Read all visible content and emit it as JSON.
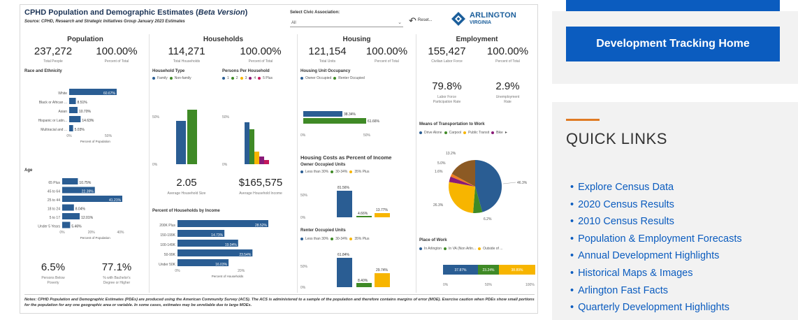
{
  "dashboard": {
    "title_main": "CPHD Population and Demographic Estimates (",
    "title_italic": "Beta Version",
    "title_end": ")",
    "source": "Source: CPHD, Research and Strategic Initiatives Group January 2023 Estimates",
    "civic_label": "Select Civic Association:",
    "civic_value": "All",
    "reset_label": "Reset...",
    "logo_line1": "ARLINGTON",
    "logo_line2": "VIRGINIA",
    "notes": "Notes: CPHD Population and Demographic Estimates (PDEs) are produced using the American Community Survey (ACS). The ACS is administered to a sample of the population and therefore contains margins of error (MOE). Exercise caution when PDEs show small portions for the population for any one geographic area or variable. In some cases, estimates may be unreliable due to large MOEs."
  },
  "population": {
    "title": "Population",
    "total": "237,272",
    "total_label": "Total People",
    "pct": "100.00%",
    "pct_label": "Percent of Total",
    "race_title": "Race and Ethnicity",
    "race": [
      {
        "label": "White",
        "value": 60.67,
        "text": "60.67%"
      },
      {
        "label": "Black or African ...",
        "value": 8.51,
        "text": "8.51%"
      },
      {
        "label": "Asian",
        "value": 10.7,
        "text": "10.70%"
      },
      {
        "label": "Hispanic or Latin...",
        "value": 14.63,
        "text": "14.63%"
      },
      {
        "label": "Multiracial and ...",
        "value": 5.03,
        "text": "5.03%"
      }
    ],
    "race_ticks": [
      "0%",
      "50%"
    ],
    "race_axis": "Percent of Population",
    "age_title": "Age",
    "age": [
      {
        "label": "65 Plus",
        "value": 10.75,
        "text": "10.75%"
      },
      {
        "label": "45 to 64",
        "value": 22.39,
        "text": "22.39%"
      },
      {
        "label": "25 to 44",
        "value": 41.21,
        "text": "41.21%"
      },
      {
        "label": "18 to 24",
        "value": 8.04,
        "text": "8.04%"
      },
      {
        "label": "5 to 17",
        "value": 12.01,
        "text": "12.01%"
      },
      {
        "label": "Under 5 Years",
        "value": 5.46,
        "text": "5.46%"
      }
    ],
    "age_ticks": [
      "0%",
      "20%",
      "40%"
    ],
    "age_axis": "Percent of Population",
    "poverty": "6.5%",
    "poverty_label1": "Persons Below",
    "poverty_label2": "Poverty",
    "bachelor": "77.1%",
    "bachelor_label1": "% with Bachelor's",
    "bachelor_label2": "Degree or Higher"
  },
  "households": {
    "title": "Households",
    "total": "114,271",
    "total_label": "Total Households",
    "pct": "100.00%",
    "pct_label": "Percent of Total",
    "type_title": "Household Type",
    "type_legend": [
      "Family",
      "Non-family"
    ],
    "pph_title": "Persons Per Household",
    "pph_legend": [
      "1",
      "2",
      "3",
      "4",
      "5 Plus"
    ],
    "tick_50": "50%",
    "tick_0": "0%",
    "avg_size": "2.05",
    "avg_size_label": "Average Household Size",
    "avg_income": "$165,575",
    "avg_income_label": "Average Household Income",
    "income_title": "Percent of Households by Income",
    "income": [
      {
        "label": "200K Plus",
        "value": 28.52,
        "text": "28.52%"
      },
      {
        "label": "150-199K",
        "value": 14.73,
        "text": "14.73%"
      },
      {
        "label": "100-149K",
        "value": 19.04,
        "text": "19.04%"
      },
      {
        "label": "50-99K",
        "value": 23.54,
        "text": "23.54%"
      },
      {
        "label": "Under 50K",
        "value": 16.03,
        "text": "16.03%"
      }
    ],
    "income_ticks": [
      "0%",
      "20%"
    ],
    "income_axis": "Percent of Households"
  },
  "housing": {
    "title": "Housing",
    "total": "121,154",
    "total_label": "Total Units",
    "pct": "100.00%",
    "pct_label": "Percent of Total",
    "occ_title": "Housing Unit Occupancy",
    "occ_legend": [
      "Owner Occupied",
      "Renter Occupied"
    ],
    "occ_owner": "38.34%",
    "occ_renter": "61.66%",
    "occ_ticks": [
      "0%",
      "50%"
    ],
    "costs_title": "Housing Costs as Percent of Income",
    "owner_title": "Owner Occupied Units",
    "costs_legend": [
      "Less than 30%",
      "30-34%",
      "35% Plus"
    ],
    "owner_vals": [
      "81.56%",
      "4.66%",
      "13.77%"
    ],
    "renter_title": "Renter Occupied Units",
    "renter_vals": [
      "61.84%",
      "8.40%",
      "29.74%"
    ],
    "tick_50": "50%",
    "tick_0": "0%"
  },
  "employment": {
    "title": "Employment",
    "total": "155,427",
    "total_label": "Civilian Labor Force",
    "pct": "100.00%",
    "pct_label": "Percent of Total",
    "lfpr": "79.8%",
    "lfpr_label1": "Labor Force",
    "lfpr_label2": "Participation Rate",
    "unemp": "2.9%",
    "unemp_label1": "Unemployment",
    "unemp_label2": "Rate",
    "transport_title": "Means of Transportation to Work",
    "transport_legend": [
      "Drive Alone",
      "Carpool",
      "Public Transit",
      "Bike"
    ],
    "pie_labels": [
      "46.3%",
      "26.3%",
      "6.2%",
      "13.2%",
      "5.0%",
      "1.6%"
    ],
    "place_title": "Place of Work",
    "place_legend": [
      "In Arlington",
      "In VA (Non Arlin...",
      "Outside of ..."
    ],
    "place_vals": [
      "37.87%",
      "23.24%",
      "38.89%"
    ],
    "place_ticks": [
      "0%",
      "50%",
      "100%"
    ]
  },
  "colors": {
    "blue": "#2a5d93",
    "green": "#3f8a26",
    "yellow": "#f7b500",
    "purple": "#8a1a77",
    "orange": "#f07c22",
    "brown": "#8c5a24",
    "logo_blue": "#1b5e9b",
    "link_blue": "#0b5cbf"
  },
  "side": {
    "dev_button": "Development Tracking Home",
    "quick_links_title": "QUICK LINKS",
    "links": [
      "Explore Census Data",
      "2020 Census Results",
      "2010 Census Results",
      "Population & Employment Forecasts",
      "Annual Development Highlights",
      "Historical Maps & Images",
      "Arlington Fast Facts",
      "Quarterly Development Highlights"
    ]
  }
}
